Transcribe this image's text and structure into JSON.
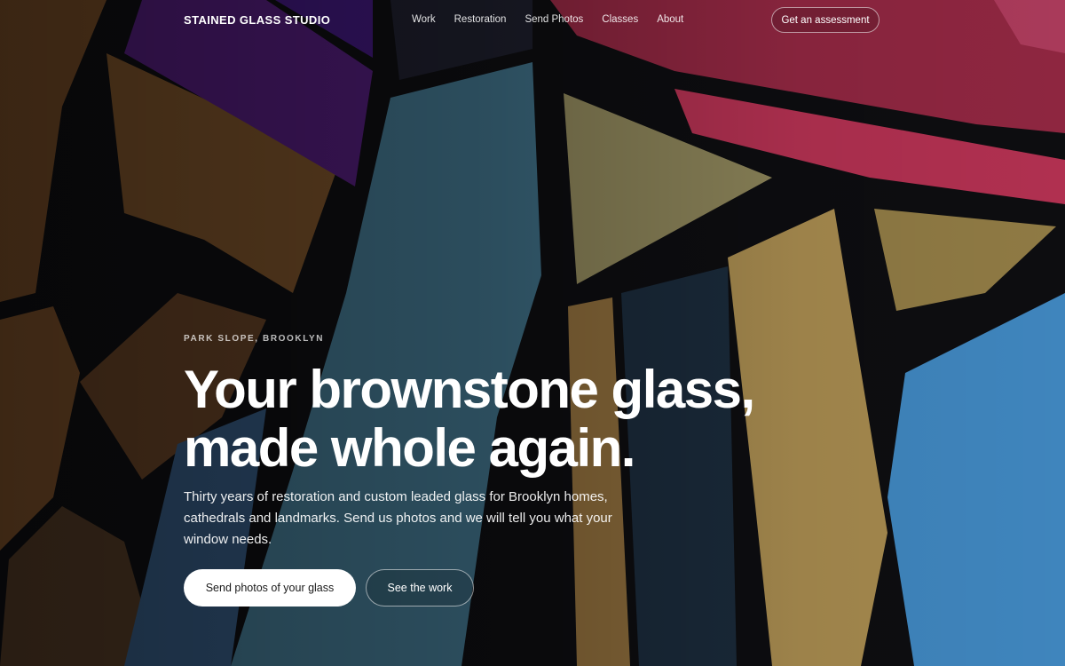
{
  "nav": {
    "brand": "STAINED GLASS STUDIO",
    "links": [
      "Work",
      "Restoration",
      "Send Photos",
      "Classes",
      "About"
    ],
    "cta": "Get an assessment"
  },
  "hero": {
    "eyebrow": "PARK SLOPE, BROOKLYN",
    "headline_line1": "Your brownstone glass,",
    "headline_line2": "made whole again.",
    "subtext": "Thirty years of restoration and custom leaded glass for Brooklyn homes, cathedrals and landmarks. Send us photos and we will tell you what your window needs.",
    "primary_button": "Send photos of your glass",
    "secondary_button": "See the work"
  },
  "colors": {
    "lead": "#0d0d10",
    "amber": "#8a5a2a",
    "purple": "#4a1a6e",
    "teal": "#3f6f86",
    "crimson": "#9c2a48",
    "olive": "#8a8258",
    "gold": "#a5894e",
    "sky": "#3f85bd"
  }
}
